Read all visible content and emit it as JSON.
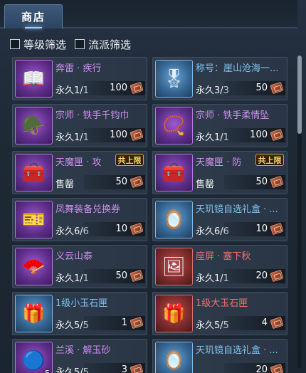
{
  "tab": {
    "label": "商店"
  },
  "filters": [
    {
      "label": "等级筛选",
      "checked": false
    },
    {
      "label": "流派筛选",
      "checked": false
    }
  ],
  "items": [
    {
      "name": "奔雷 · 疾行",
      "quality": "purple",
      "duration": "永久1/1",
      "price": "100",
      "icon": "book-icon"
    },
    {
      "name": "称号：崖山沧海一...",
      "quality": "blue",
      "duration": "永久3/3",
      "price": "50",
      "icon": "title-token-icon"
    },
    {
      "name": "宗师 · 铁手千钧巾",
      "quality": "purple",
      "duration": "永久1/1",
      "price": "100",
      "icon": "headgear-icon"
    },
    {
      "name": "宗师 · 铁手柔情坠",
      "quality": "purple",
      "duration": "永久1/1",
      "price": "100",
      "icon": "pendant-icon"
    },
    {
      "name": "天魔匣 · 攻",
      "quality": "purple",
      "duration": "售罄",
      "price": "50",
      "icon": "chest-icon",
      "badge": "共上限"
    },
    {
      "name": "天魔匣 · 防",
      "quality": "purple",
      "duration": "售罄",
      "price": "50",
      "icon": "chest-icon",
      "badge": "共上限"
    },
    {
      "name": "凤舞装备兑换券",
      "quality": "purple",
      "duration": "永久6/6",
      "price": "10",
      "icon": "voucher-icon"
    },
    {
      "name": "天玑镜自选礼盒 · ...",
      "quality": "blue",
      "duration": "永久6/6",
      "price": "10",
      "icon": "mirror-icon"
    },
    {
      "name": "义云山泰",
      "quality": "purple",
      "duration": "永久1/1",
      "price": "50",
      "icon": "fan-icon"
    },
    {
      "name": "座屏 · 塞下秋",
      "quality": "red",
      "duration": "永久1/1",
      "price": "20",
      "icon": "screen-icon"
    },
    {
      "name": "1级小玉石匣",
      "quality": "blue",
      "duration": "永久5/5",
      "price": "1",
      "icon": "gem-box-icon"
    },
    {
      "name": "1级大玉石匣",
      "quality": "red",
      "duration": "永久5/5",
      "price": "4",
      "icon": "gem-box-icon"
    },
    {
      "name": "兰溪 · 解玉砂",
      "quality": "purple",
      "duration": "永久5/5",
      "price": "3",
      "icon": "sand-icon",
      "stack": "5"
    },
    {
      "name": "天玑镜自选礼盒 · ...",
      "quality": "blue",
      "duration": "",
      "price": "20",
      "icon": "mirror-icon"
    }
  ]
}
